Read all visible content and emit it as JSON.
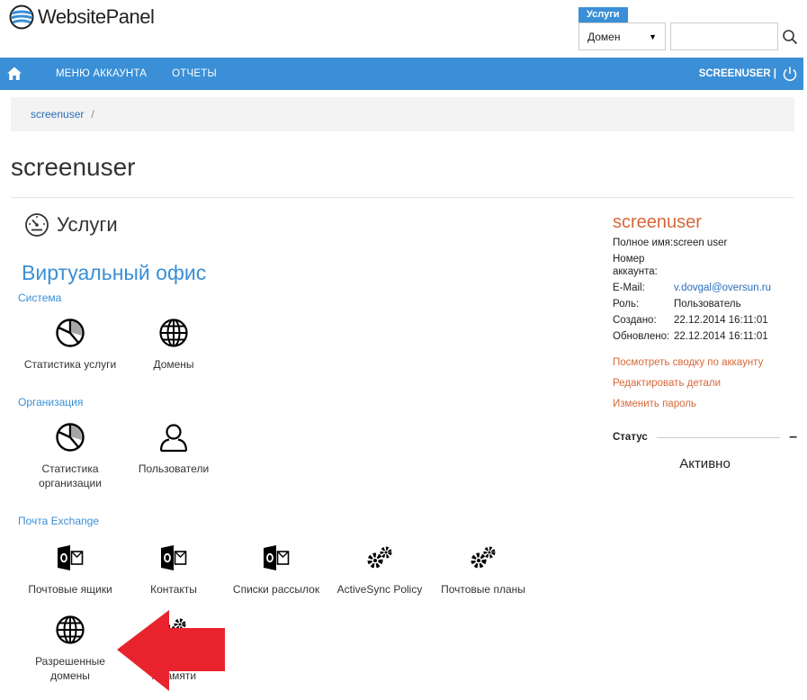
{
  "brand": {
    "logo_text": "WebsitePanel"
  },
  "search": {
    "tab_label": "Услуги",
    "select_value": "Домен",
    "input_value": ""
  },
  "nav": {
    "items": [
      "МЕНЮ АККАУНТА",
      "ОТЧЕТЫ"
    ],
    "user_label": "SCREENUSER |"
  },
  "breadcrumb": {
    "item": "screenuser",
    "sep": "/"
  },
  "page": {
    "title": "screenuser"
  },
  "services": {
    "heading": "Услуги",
    "section_title": "Виртуальный офис",
    "groups": [
      {
        "label": "Система",
        "tiles": [
          "Статистика услуги",
          "Домены"
        ]
      },
      {
        "label": "Организация",
        "tiles": [
          "Статистика организации",
          "Пользователи"
        ]
      },
      {
        "label": "Почта Exchange",
        "tiles": [
          "Почтовые ящики",
          "Контакты",
          "Списки рассылок",
          "ActiveSync Policy",
          "Почтовые планы",
          "Разрешенные домены",
          "...памяти"
        ]
      }
    ]
  },
  "account": {
    "username": "screenuser",
    "full_name_label": "Полное имя:",
    "full_name": "screen user",
    "number_label": "Номер аккаунта:",
    "number": "",
    "email_label": "E-Mail:",
    "email": "v.dovgal@oversun.ru",
    "role_label": "Роль:",
    "role": "Пользователь",
    "created_label": "Создано:",
    "created": "22.12.2014 16:11:01",
    "updated_label": "Обновлено:",
    "updated": "22.12.2014 16:11:01",
    "links": [
      "Посмотреть сводку по аккаунту",
      "Редактировать детали",
      "Изменить пароль"
    ],
    "status_label": "Статус",
    "status_toggle": "–",
    "status_value": "Активно"
  },
  "colors": {
    "accent": "#3a8fd6",
    "link_orange": "#d6683a",
    "arrow": "#e8232d"
  },
  "icons": {
    "logo": "globe-logo-icon",
    "search": "search-icon",
    "home": "home-icon",
    "power": "power-icon",
    "services": "speedometer-icon",
    "stats": "pie-chart-icon",
    "domains": "globe-icon",
    "users": "user-icon",
    "mailbox": "outlook-icon",
    "policy": "gears-icon"
  }
}
